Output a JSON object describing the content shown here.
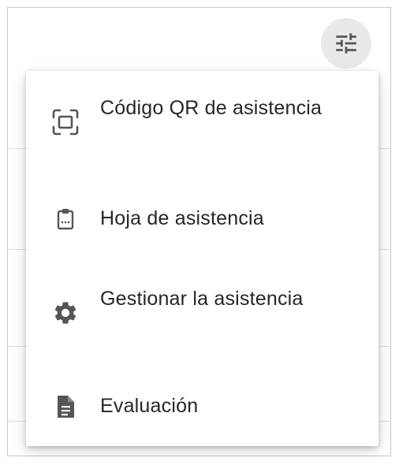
{
  "toolbar": {
    "filter_icon": "tune-sliders-icon"
  },
  "menu": {
    "items": [
      {
        "label": "Código QR de asistencia",
        "icon": "qr-scan-icon"
      },
      {
        "label": "Hoja de asistencia",
        "icon": "clipboard-icon"
      },
      {
        "label": "Gestionar la asistencia",
        "icon": "gear-icon"
      },
      {
        "label": "Evaluación",
        "icon": "document-icon"
      }
    ]
  },
  "colors": {
    "text": "#262626",
    "icon": "#555555",
    "button_bg": "#e9e9e9",
    "divider": "#dddddd"
  }
}
